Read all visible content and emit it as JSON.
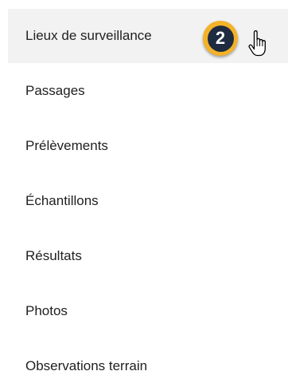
{
  "menu": {
    "items": [
      {
        "label": "Lieux de surveillance"
      },
      {
        "label": "Passages"
      },
      {
        "label": "Prélèvements"
      },
      {
        "label": "Échantillons"
      },
      {
        "label": "Résultats"
      },
      {
        "label": "Photos"
      },
      {
        "label": "Observations terrain"
      }
    ],
    "active_index": 0
  },
  "step_badge": {
    "number": "2"
  },
  "colors": {
    "badge_ring": "#f3b228",
    "badge_fill": "#1e2b40",
    "active_background": "#f2f2f2",
    "text": "#212121"
  },
  "icons": {
    "cursor": "hand-pointer-icon"
  }
}
